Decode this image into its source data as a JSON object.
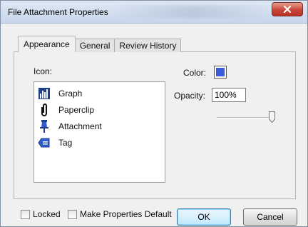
{
  "window": {
    "title": "File Attachment Properties",
    "close_icon": "close-icon"
  },
  "tabs": [
    {
      "label": "Appearance",
      "active": true
    },
    {
      "label": "General",
      "active": false
    },
    {
      "label": "Review History",
      "active": false
    }
  ],
  "appearance": {
    "icon_label": "Icon:",
    "icons": [
      {
        "label": "Graph",
        "icon": "graph-icon"
      },
      {
        "label": "Paperclip",
        "icon": "paperclip-icon"
      },
      {
        "label": "Attachment",
        "icon": "pushpin-icon"
      },
      {
        "label": "Tag",
        "icon": "tag-icon"
      }
    ],
    "color_label": "Color:",
    "color_value": "#3b5bdb",
    "opacity_label": "Opacity:",
    "opacity_value": "100%",
    "opacity_slider_fraction": 1.0
  },
  "footer": {
    "locked_label": "Locked",
    "locked_checked": false,
    "make_default_label": "Make Properties Default",
    "make_default_checked": false,
    "ok_label": "OK",
    "cancel_label": "Cancel"
  }
}
